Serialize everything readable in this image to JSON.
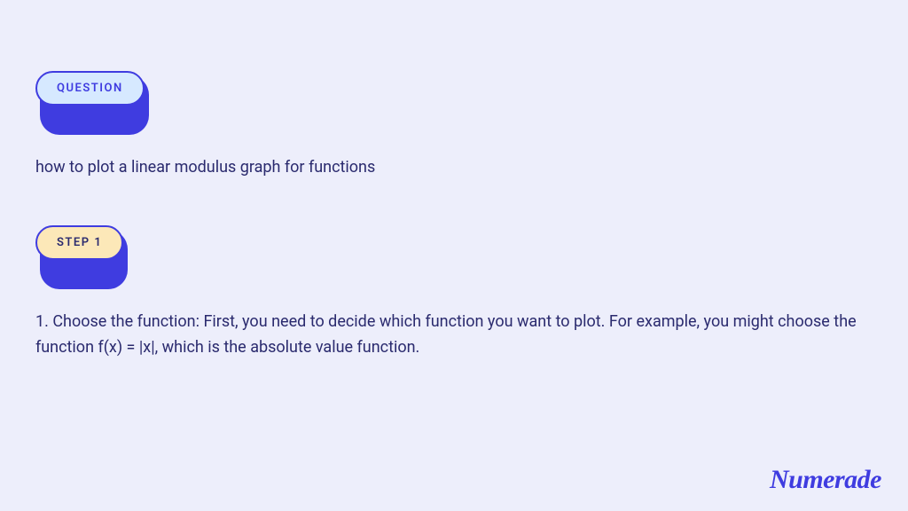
{
  "badges": {
    "question_label": "QUESTION",
    "step_label": "STEP 1"
  },
  "question_text": "how to plot a linear modulus graph for functions",
  "step_text": "1. Choose the function: First, you need to decide which function you want to plot. For example, you might choose the function f(x) = |x|, which is the absolute value function.",
  "brand": "Numerade"
}
